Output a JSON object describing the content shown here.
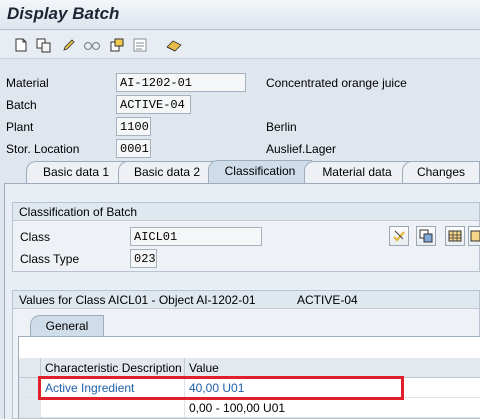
{
  "window": {
    "title": "Display Batch"
  },
  "toolbar": {
    "icons": [
      "new-document-icon",
      "copy-icon",
      "edit-pencil-icon",
      "glasses-icon",
      "other-object-icon",
      "list-icon",
      "where-used-icon"
    ]
  },
  "header": {
    "material": {
      "label": "Material",
      "value": "AI-1202-01",
      "description": "Concentrated orange juice"
    },
    "batch": {
      "label": "Batch",
      "value": "ACTIVE-04"
    },
    "plant": {
      "label": "Plant",
      "value": "1100",
      "description": "Berlin"
    },
    "stor_location": {
      "label": "Stor. Location",
      "value": "0001",
      "description": "Auslief.Lager"
    }
  },
  "tabs": [
    {
      "label": "Basic data 1"
    },
    {
      "label": "Basic data 2"
    },
    {
      "label": "Classification",
      "active": true
    },
    {
      "label": "Material data"
    },
    {
      "label": "Changes"
    }
  ],
  "classification": {
    "group_title": "Classification of Batch",
    "class": {
      "label": "Class",
      "value": "AICL01"
    },
    "class_type": {
      "label": "Class Type",
      "value": "023"
    }
  },
  "values": {
    "header_left": "Values for Class AICL01 - Object AI-1202-01",
    "header_right": "ACTIVE-04",
    "subtab": "General",
    "columns": [
      "Characteristic Description",
      "Value"
    ],
    "rows": [
      {
        "description": "Active Ingredient",
        "value": "40,00 U01",
        "highlighted": true
      },
      {
        "description": "",
        "value": "0,00 - 100,00 U01"
      }
    ]
  },
  "colors": {
    "highlight": "#e0202a",
    "link": "#1f5fa9"
  }
}
